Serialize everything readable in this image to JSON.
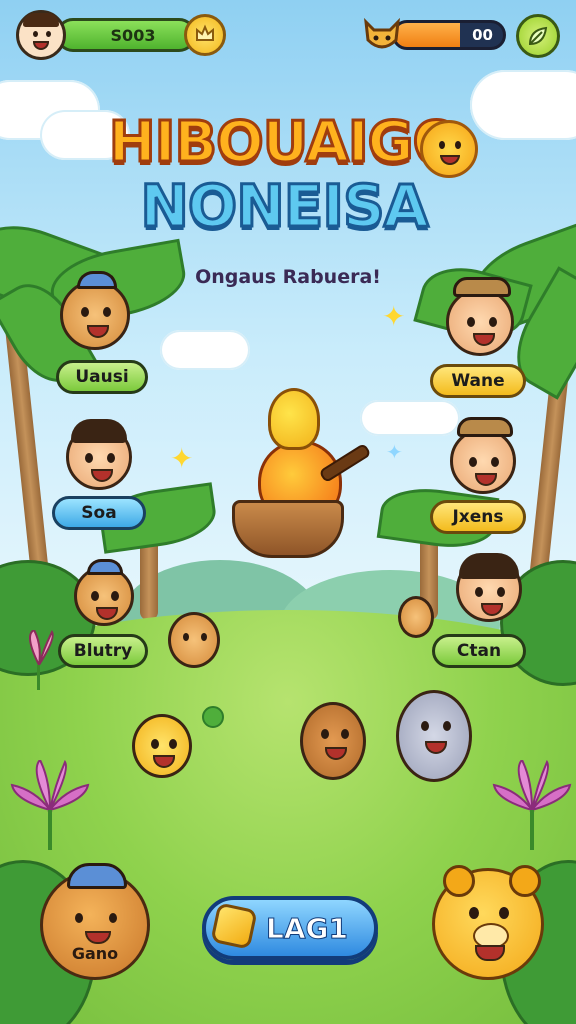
{
  "hud": {
    "score": "S003",
    "energy_value": "00",
    "energy_fraction": 0.6,
    "coin_icon": "crown-icon",
    "settings_icon": "leaf-icon"
  },
  "title": {
    "line1": "HIBOUAIGO",
    "line2": "NONEISA",
    "subtitle": "Ongaus Rabuera!"
  },
  "characters_left": [
    {
      "name": "Uausi"
    },
    {
      "name": "Soa"
    },
    {
      "name": "Blutry"
    }
  ],
  "characters_right": [
    {
      "name": "Wane"
    },
    {
      "name": "Jxens"
    },
    {
      "name": "Ctan"
    }
  ],
  "buttons": {
    "play_label": "LAG1",
    "left_corner_label": "Gano"
  },
  "colors": {
    "accent_orange": "#f3a818",
    "accent_blue": "#2f8ae0",
    "grass_green": "#8fd24d"
  }
}
